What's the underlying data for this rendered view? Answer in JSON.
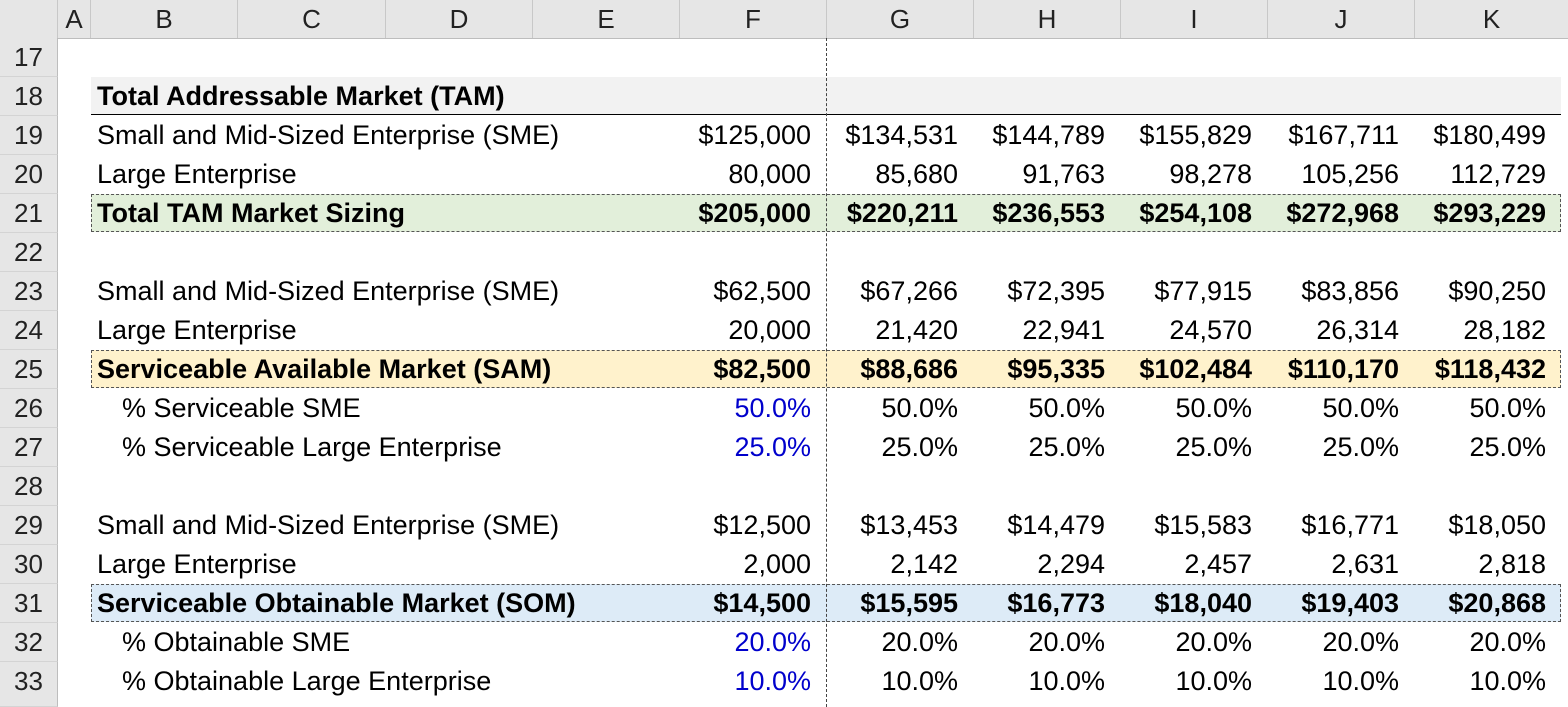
{
  "columns": [
    "A",
    "B",
    "C",
    "D",
    "E",
    "F",
    "G",
    "H",
    "I",
    "J",
    "K"
  ],
  "row_numbers": [
    "17",
    "18",
    "19",
    "20",
    "21",
    "22",
    "23",
    "24",
    "25",
    "26",
    "27",
    "28",
    "29",
    "30",
    "31",
    "32",
    "33"
  ],
  "rows": [
    {
      "label": "",
      "values": []
    },
    {
      "label": "Total Addressable Market (TAM)",
      "values": []
    },
    {
      "label": "Small and Mid-Sized Enterprise (SME)",
      "values": [
        "$125,000",
        "$134,531",
        "$144,789",
        "$155,829",
        "$167,711",
        "$180,499"
      ]
    },
    {
      "label": "Large Enterprise",
      "values": [
        "80,000",
        "85,680",
        "91,763",
        "98,278",
        "105,256",
        "112,729"
      ]
    },
    {
      "label": "Total TAM Market Sizing",
      "values": [
        "$205,000",
        "$220,211",
        "$236,553",
        "$254,108",
        "$272,968",
        "$293,229"
      ]
    },
    {
      "label": "",
      "values": []
    },
    {
      "label": "Small and Mid-Sized Enterprise (SME)",
      "values": [
        "$62,500",
        "$67,266",
        "$72,395",
        "$77,915",
        "$83,856",
        "$90,250"
      ]
    },
    {
      "label": "Large Enterprise",
      "values": [
        "20,000",
        "21,420",
        "22,941",
        "24,570",
        "26,314",
        "28,182"
      ]
    },
    {
      "label": "Serviceable Available Market (SAM)",
      "values": [
        "$82,500",
        "$88,686",
        "$95,335",
        "$102,484",
        "$110,170",
        "$118,432"
      ]
    },
    {
      "label": "% Serviceable SME",
      "values": [
        "50.0%",
        "50.0%",
        "50.0%",
        "50.0%",
        "50.0%",
        "50.0%"
      ]
    },
    {
      "label": "% Serviceable Large Enterprise",
      "values": [
        "25.0%",
        "25.0%",
        "25.0%",
        "25.0%",
        "25.0%",
        "25.0%"
      ]
    },
    {
      "label": "",
      "values": []
    },
    {
      "label": "Small and Mid-Sized Enterprise (SME)",
      "values": [
        "$12,500",
        "$13,453",
        "$14,479",
        "$15,583",
        "$16,771",
        "$18,050"
      ]
    },
    {
      "label": "Large Enterprise",
      "values": [
        "2,000",
        "2,142",
        "2,294",
        "2,457",
        "2,631",
        "2,818"
      ]
    },
    {
      "label": "Serviceable Obtainable Market (SOM)",
      "values": [
        "$14,500",
        "$15,595",
        "$16,773",
        "$18,040",
        "$19,403",
        "$20,868"
      ]
    },
    {
      "label": "% Obtainable SME",
      "values": [
        "20.0%",
        "20.0%",
        "20.0%",
        "20.0%",
        "20.0%",
        "20.0%"
      ]
    },
    {
      "label": "% Obtainable Large Enterprise",
      "values": [
        "10.0%",
        "10.0%",
        "10.0%",
        "10.0%",
        "10.0%",
        "10.0%"
      ]
    }
  ],
  "colors": {
    "tam_fill": "#e2efda",
    "sam_fill": "#fff2cc",
    "som_fill": "#ddebf7",
    "header_fill": "#f2f2f2",
    "input_blue": "#0000cc"
  }
}
